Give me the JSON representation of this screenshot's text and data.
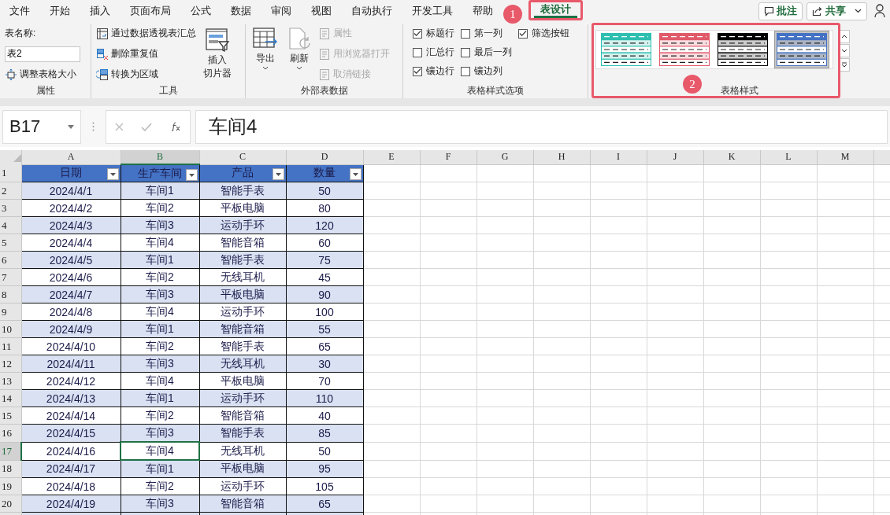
{
  "menu_tabs": [
    {
      "label": "文件",
      "selected": false
    },
    {
      "label": "开始",
      "selected": false
    },
    {
      "label": "插入",
      "selected": false
    },
    {
      "label": "页面布局",
      "selected": false
    },
    {
      "label": "公式",
      "selected": false
    },
    {
      "label": "数据",
      "selected": false
    },
    {
      "label": "审阅",
      "selected": false
    },
    {
      "label": "视图",
      "selected": false
    },
    {
      "label": "自动执行",
      "selected": false
    },
    {
      "label": "开发工具",
      "selected": false
    },
    {
      "label": "帮助",
      "selected": false
    },
    {
      "label": "表设计",
      "selected": true
    }
  ],
  "top_buttons": {
    "comment": "批注",
    "share": "共享"
  },
  "callouts": [
    "1",
    "2"
  ],
  "ribbon": {
    "properties": {
      "name_label": "表名称:",
      "name_value": "表2",
      "resize": "调整表格大小",
      "group": "属性"
    },
    "tools": {
      "items": [
        {
          "label": "通过数据透视表汇总",
          "kind": "pivot"
        },
        {
          "label": "删除重复值",
          "kind": "dedupe"
        },
        {
          "label": "转换为区域",
          "kind": "convert"
        }
      ],
      "slicer": [
        "插入",
        "切片器"
      ],
      "group": "工具"
    },
    "external": {
      "export": "导出",
      "refresh": "刷新",
      "items": [
        {
          "label": "属性",
          "disabled": true
        },
        {
          "label": "用浏览器打开",
          "disabled": true
        },
        {
          "label": "取消链接",
          "disabled": true
        }
      ],
      "group": "外部表数据"
    },
    "options": {
      "items": [
        {
          "label": "标题行",
          "checked": true
        },
        {
          "label": "汇总行",
          "checked": false
        },
        {
          "label": "镶边行",
          "checked": true
        },
        {
          "label": "第一列",
          "checked": false
        },
        {
          "label": "最后一列",
          "checked": false
        },
        {
          "label": "镶边列",
          "checked": false
        },
        {
          "label": "筛选按钮",
          "checked": true
        }
      ],
      "group": "表格样式选项"
    },
    "styles": {
      "items": [
        {
          "color": "#2ebfb0",
          "selected": false
        },
        {
          "color": "#e05a6a",
          "selected": false
        },
        {
          "color": "#000000",
          "selected": false
        },
        {
          "color": "#4472c4",
          "selected": true
        }
      ],
      "group": "表格样式"
    }
  },
  "formula_bar": {
    "name_box": "B17",
    "value": "车间4"
  },
  "sheet": {
    "columns": [
      {
        "label": "A",
        "selected": false
      },
      {
        "label": "B",
        "selected": true
      },
      {
        "label": "C",
        "selected": false
      },
      {
        "label": "D",
        "selected": false
      },
      {
        "label": "E",
        "selected": false
      },
      {
        "label": "F",
        "selected": false
      },
      {
        "label": "G",
        "selected": false
      },
      {
        "label": "H",
        "selected": false
      },
      {
        "label": "I",
        "selected": false
      },
      {
        "label": "J",
        "selected": false
      },
      {
        "label": "K",
        "selected": false
      },
      {
        "label": "L",
        "selected": false
      },
      {
        "label": "M",
        "selected": false
      }
    ],
    "header_row_number": "1",
    "header": [
      "日期",
      "生产车间",
      "产品",
      "数量"
    ],
    "rows": [
      {
        "number": "2",
        "selected": false,
        "cells": [
          {
            "text": "2024/4/1",
            "selected": false
          },
          {
            "text": "车间1",
            "selected": false
          },
          {
            "text": "智能手表",
            "selected": false
          },
          {
            "text": "50",
            "selected": false
          }
        ]
      },
      {
        "number": "3",
        "selected": false,
        "cells": [
          {
            "text": "2024/4/2",
            "selected": false
          },
          {
            "text": "车间2",
            "selected": false
          },
          {
            "text": "平板电脑",
            "selected": false
          },
          {
            "text": "80",
            "selected": false
          }
        ]
      },
      {
        "number": "4",
        "selected": false,
        "cells": [
          {
            "text": "2024/4/3",
            "selected": false
          },
          {
            "text": "车间3",
            "selected": false
          },
          {
            "text": "运动手环",
            "selected": false
          },
          {
            "text": "120",
            "selected": false
          }
        ]
      },
      {
        "number": "5",
        "selected": false,
        "cells": [
          {
            "text": "2024/4/4",
            "selected": false
          },
          {
            "text": "车间4",
            "selected": false
          },
          {
            "text": "智能音箱",
            "selected": false
          },
          {
            "text": "60",
            "selected": false
          }
        ]
      },
      {
        "number": "6",
        "selected": false,
        "cells": [
          {
            "text": "2024/4/5",
            "selected": false
          },
          {
            "text": "车间1",
            "selected": false
          },
          {
            "text": "智能手表",
            "selected": false
          },
          {
            "text": "75",
            "selected": false
          }
        ]
      },
      {
        "number": "7",
        "selected": false,
        "cells": [
          {
            "text": "2024/4/6",
            "selected": false
          },
          {
            "text": "车间2",
            "selected": false
          },
          {
            "text": "无线耳机",
            "selected": false
          },
          {
            "text": "45",
            "selected": false
          }
        ]
      },
      {
        "number": "8",
        "selected": false,
        "cells": [
          {
            "text": "2024/4/7",
            "selected": false
          },
          {
            "text": "车间3",
            "selected": false
          },
          {
            "text": "平板电脑",
            "selected": false
          },
          {
            "text": "90",
            "selected": false
          }
        ]
      },
      {
        "number": "9",
        "selected": false,
        "cells": [
          {
            "text": "2024/4/8",
            "selected": false
          },
          {
            "text": "车间4",
            "selected": false
          },
          {
            "text": "运动手环",
            "selected": false
          },
          {
            "text": "100",
            "selected": false
          }
        ]
      },
      {
        "number": "10",
        "selected": false,
        "cells": [
          {
            "text": "2024/4/9",
            "selected": false
          },
          {
            "text": "车间1",
            "selected": false
          },
          {
            "text": "智能音箱",
            "selected": false
          },
          {
            "text": "55",
            "selected": false
          }
        ]
      },
      {
        "number": "11",
        "selected": false,
        "cells": [
          {
            "text": "2024/4/10",
            "selected": false
          },
          {
            "text": "车间2",
            "selected": false
          },
          {
            "text": "智能手表",
            "selected": false
          },
          {
            "text": "65",
            "selected": false
          }
        ]
      },
      {
        "number": "12",
        "selected": false,
        "cells": [
          {
            "text": "2024/4/11",
            "selected": false
          },
          {
            "text": "车间3",
            "selected": false
          },
          {
            "text": "无线耳机",
            "selected": false
          },
          {
            "text": "30",
            "selected": false
          }
        ]
      },
      {
        "number": "13",
        "selected": false,
        "cells": [
          {
            "text": "2024/4/12",
            "selected": false
          },
          {
            "text": "车间4",
            "selected": false
          },
          {
            "text": "平板电脑",
            "selected": false
          },
          {
            "text": "70",
            "selected": false
          }
        ]
      },
      {
        "number": "14",
        "selected": false,
        "cells": [
          {
            "text": "2024/4/13",
            "selected": false
          },
          {
            "text": "车间1",
            "selected": false
          },
          {
            "text": "运动手环",
            "selected": false
          },
          {
            "text": "110",
            "selected": false
          }
        ]
      },
      {
        "number": "15",
        "selected": false,
        "cells": [
          {
            "text": "2024/4/14",
            "selected": false
          },
          {
            "text": "车间2",
            "selected": false
          },
          {
            "text": "智能音箱",
            "selected": false
          },
          {
            "text": "40",
            "selected": false
          }
        ]
      },
      {
        "number": "16",
        "selected": false,
        "cells": [
          {
            "text": "2024/4/15",
            "selected": false
          },
          {
            "text": "车间3",
            "selected": false
          },
          {
            "text": "智能手表",
            "selected": false
          },
          {
            "text": "85",
            "selected": false
          }
        ]
      },
      {
        "number": "17",
        "selected": true,
        "cells": [
          {
            "text": "2024/4/16",
            "selected": false
          },
          {
            "text": "车间4",
            "selected": true
          },
          {
            "text": "无线耳机",
            "selected": false
          },
          {
            "text": "50",
            "selected": false
          }
        ]
      },
      {
        "number": "18",
        "selected": false,
        "cells": [
          {
            "text": "2024/4/17",
            "selected": false
          },
          {
            "text": "车间1",
            "selected": false
          },
          {
            "text": "平板电脑",
            "selected": false
          },
          {
            "text": "95",
            "selected": false
          }
        ]
      },
      {
        "number": "19",
        "selected": false,
        "cells": [
          {
            "text": "2024/4/18",
            "selected": false
          },
          {
            "text": "车间2",
            "selected": false
          },
          {
            "text": "运动手环",
            "selected": false
          },
          {
            "text": "105",
            "selected": false
          }
        ]
      },
      {
        "number": "20",
        "selected": false,
        "cells": [
          {
            "text": "2024/4/19",
            "selected": false
          },
          {
            "text": "车间3",
            "selected": false
          },
          {
            "text": "智能音箱",
            "selected": false
          },
          {
            "text": "65",
            "selected": false
          }
        ]
      }
    ]
  }
}
